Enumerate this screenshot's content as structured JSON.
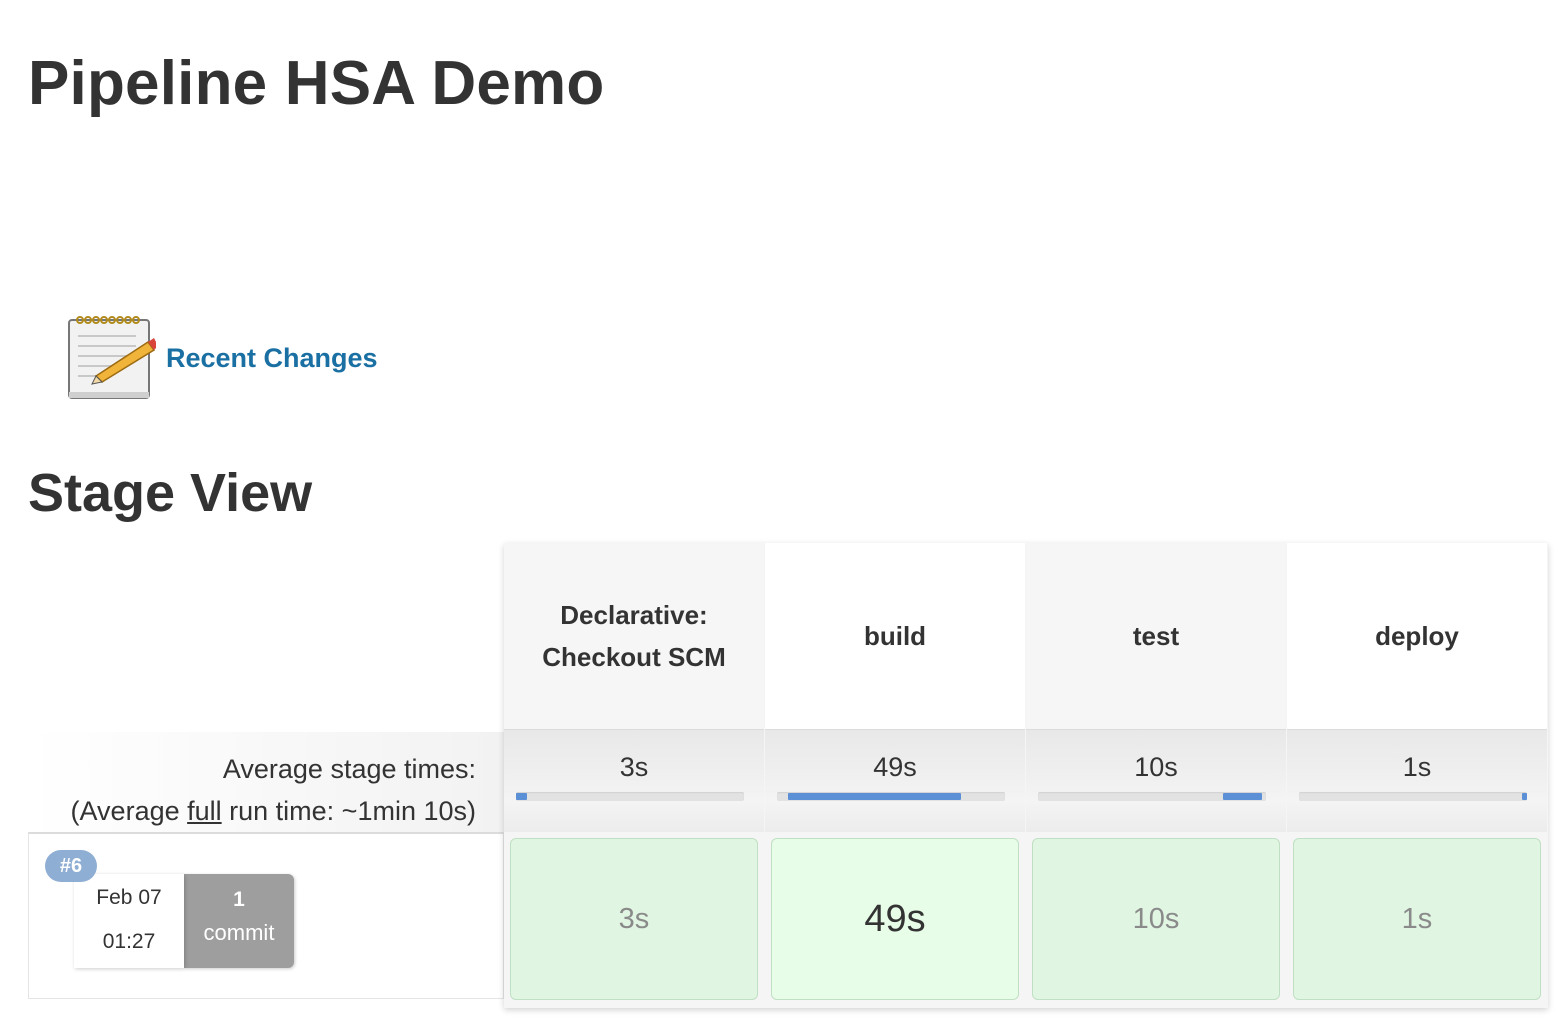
{
  "page": {
    "title": "Pipeline HSA Demo"
  },
  "links": {
    "recent_changes": "Recent Changes",
    "recent_changes_icon": "notepad-icon"
  },
  "stage_view": {
    "title": "Stage View",
    "average_label": "Average stage times:",
    "full_run_prefix": "(Average ",
    "full_run_link": "full",
    "full_run_suffix": " run time: ~1min 10s)",
    "stages": [
      {
        "name": "Declarative: Checkout SCM",
        "avg": "3s",
        "avg_fraction": 0.05,
        "bar_start": 0.0,
        "run": "3s"
      },
      {
        "name": "build",
        "avg": "49s",
        "avg_fraction": 0.76,
        "bar_start": 0.05,
        "run": "49s"
      },
      {
        "name": "test",
        "avg": "10s",
        "avg_fraction": 0.17,
        "bar_start": 0.81,
        "run": "10s"
      },
      {
        "name": "deploy",
        "avg": "1s",
        "avg_fraction": 0.02,
        "bar_start": 0.98,
        "run": "1s"
      }
    ],
    "run": {
      "badge": "#6",
      "date": "Feb 07",
      "time": "01:27",
      "commit_count": "1",
      "commit_label": "commit"
    },
    "colors": {
      "success_light": "#e0f6e2",
      "success": "#e8fde8",
      "bar_fill": "#5b8fd6",
      "badge": "#8faed3"
    }
  }
}
